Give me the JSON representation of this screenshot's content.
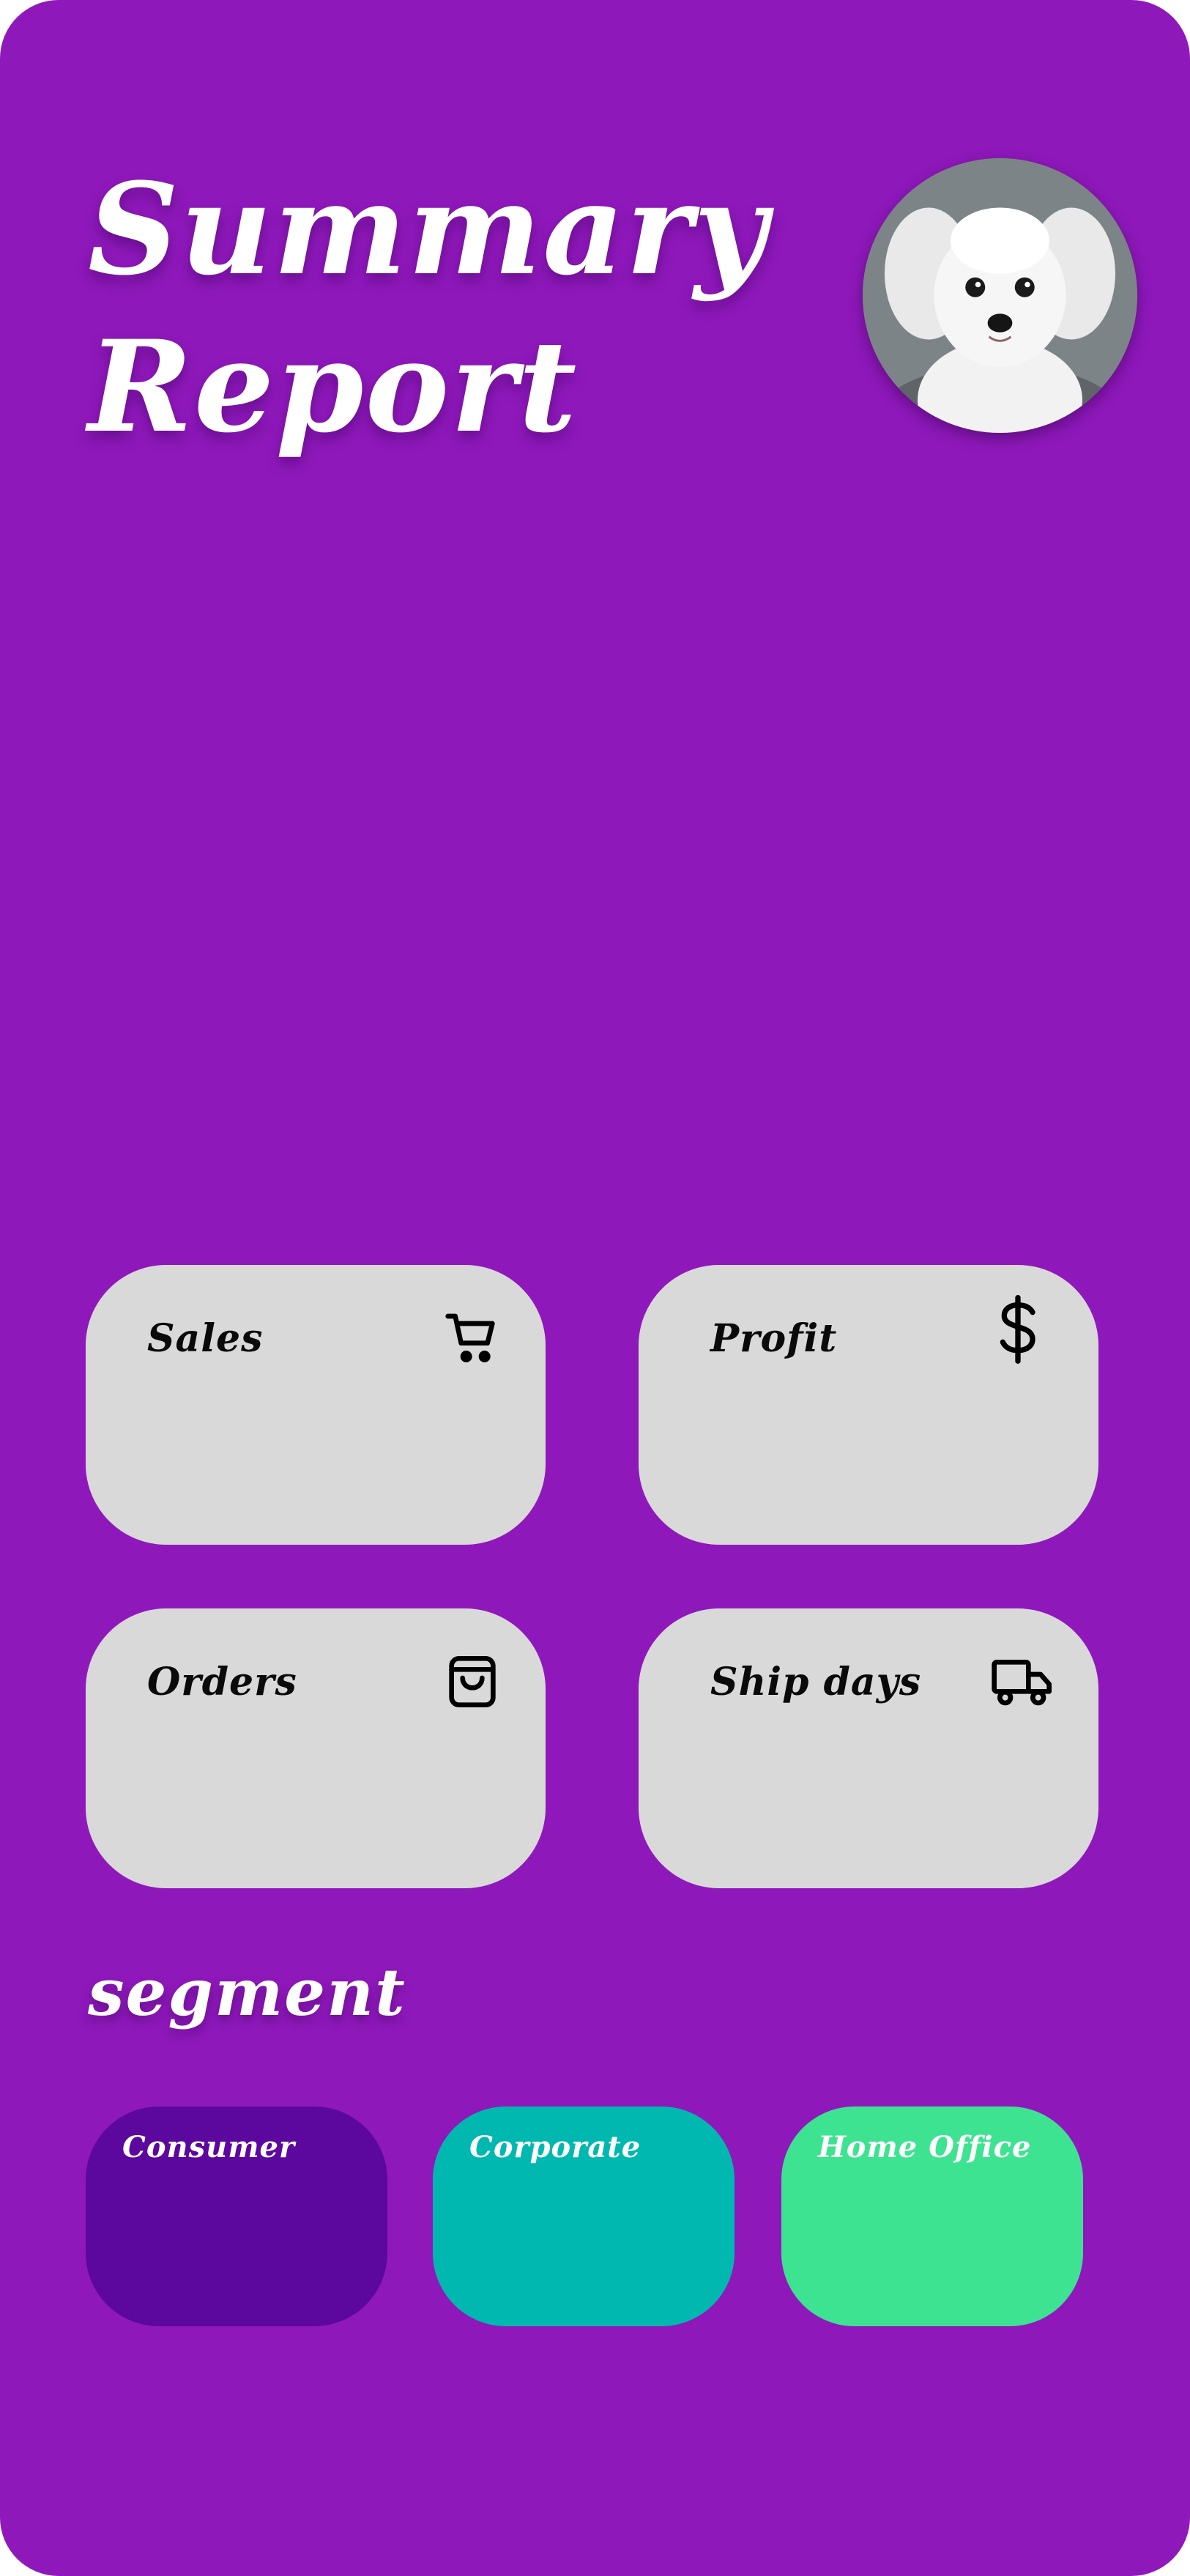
{
  "header": {
    "title_line1": "Summary",
    "title_line2": "Report",
    "avatar_icon": "dog-photo"
  },
  "kpis": [
    {
      "label": "Sales",
      "icon": "shopping-cart-icon"
    },
    {
      "label": "Profit",
      "icon": "dollar-icon"
    },
    {
      "label": "Orders",
      "icon": "shopping-bag-icon"
    },
    {
      "label": "Ship days",
      "icon": "truck-icon"
    }
  ],
  "segment": {
    "title": "segment",
    "items": [
      {
        "label": "Consumer",
        "color": "#5c089f"
      },
      {
        "label": "Corporate",
        "color": "#00b8b0"
      },
      {
        "label": "Home Office",
        "color": "#3ee391"
      }
    ]
  },
  "colors": {
    "background": "#8f18bb",
    "card": "#d9d9d9"
  }
}
